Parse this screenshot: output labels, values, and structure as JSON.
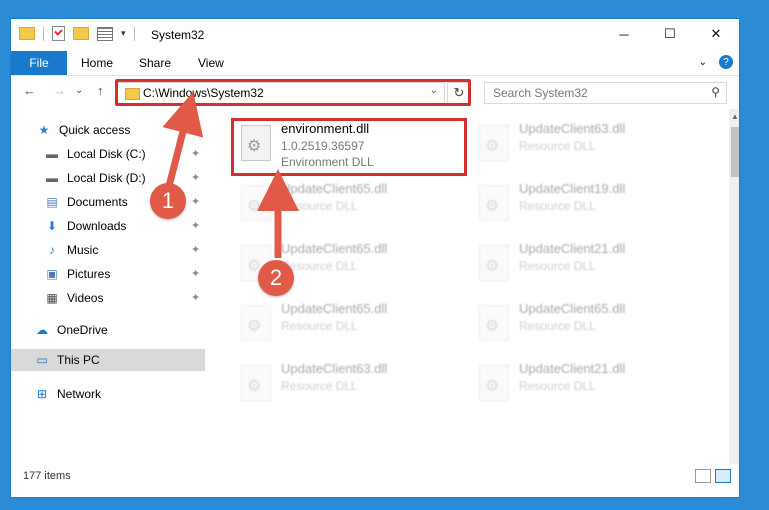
{
  "window": {
    "title": "System32",
    "controls": {
      "minimize": "─",
      "maximize": "☐",
      "close": "✕"
    }
  },
  "ribbon": {
    "tabs": [
      "File",
      "Home",
      "Share",
      "View"
    ],
    "expand_glyph": "⌄",
    "help_glyph": "?"
  },
  "nav": {
    "back": "←",
    "forward": "→",
    "dropdown": "⌄",
    "up": "↑",
    "address": "C:\\Windows\\System32",
    "address_caret": "⌄",
    "refresh": "↻",
    "search_placeholder": "Search System32",
    "search_icon": "search-icon"
  },
  "sidebar": {
    "items": [
      {
        "label": "Quick access",
        "icon": "★"
      },
      {
        "label": "Local Disk (C:)",
        "icon": "▬",
        "pinned": true
      },
      {
        "label": "Local Disk (D:)",
        "icon": "▬",
        "pinned": true
      },
      {
        "label": "Documents",
        "icon": "▤",
        "pinned": true
      },
      {
        "label": "Downloads",
        "icon": "⬇",
        "pinned": true
      },
      {
        "label": "Music",
        "icon": "♪",
        "pinned": true
      },
      {
        "label": "Pictures",
        "icon": "▣",
        "pinned": true
      },
      {
        "label": "Videos",
        "icon": "▦",
        "pinned": true
      },
      {
        "label": "OneDrive",
        "icon": "☁"
      },
      {
        "label": "This PC",
        "icon": "▭"
      },
      {
        "label": "Network",
        "icon": "⊞"
      }
    ],
    "pin_glyph": "📌"
  },
  "files": [
    {
      "name": "environment.dll",
      "line2": "1.0.2519.36597",
      "line3": "Environment DLL"
    },
    {
      "name": "UpdateClient63.dll",
      "line2": "Resource DLL",
      "line3": ""
    },
    {
      "name": "UpdateClient65.dll",
      "line2": "Resource DLL",
      "line3": ""
    },
    {
      "name": "UpdateClient19.dll",
      "line2": "Resource DLL",
      "line3": ""
    },
    {
      "name": "UpdateClient65.dll",
      "line2": "Resource DLL",
      "line3": ""
    },
    {
      "name": "UpdateClient21.dll",
      "line2": "Resource DLL",
      "line3": ""
    },
    {
      "name": "UpdateClient65.dll",
      "line2": "Resource DLL",
      "line3": ""
    },
    {
      "name": "UpdateClient65.dll",
      "line2": "Resource DLL",
      "line3": ""
    },
    {
      "name": "UpdateClient63.dll",
      "line2": "Resource DLL",
      "line3": ""
    },
    {
      "name": "UpdateClient21.dll",
      "line2": "Resource DLL",
      "line3": ""
    }
  ],
  "status": {
    "item_count": "177 items"
  },
  "annotations": {
    "marker1": "1",
    "marker2": "2",
    "color": "#d32f2f"
  }
}
